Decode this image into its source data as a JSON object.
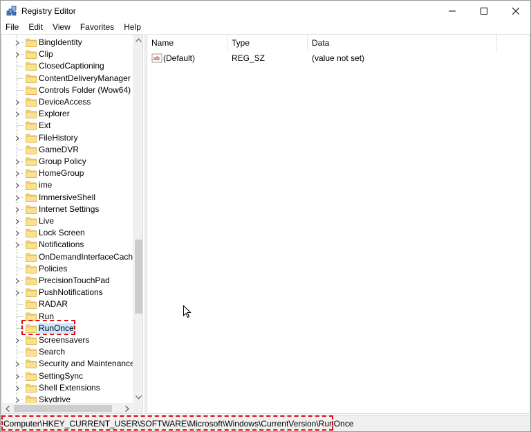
{
  "window": {
    "title": "Registry Editor",
    "controls": {
      "minimize": "—",
      "maximize": "☐",
      "close": "✕"
    }
  },
  "menu": [
    "File",
    "Edit",
    "View",
    "Favorites",
    "Help"
  ],
  "tree": {
    "items": [
      {
        "label": "BingIdentity",
        "expandable": true
      },
      {
        "label": "Clip",
        "expandable": true
      },
      {
        "label": "ClosedCaptioning",
        "expandable": false
      },
      {
        "label": "ContentDeliveryManager",
        "expandable": false
      },
      {
        "label": "Controls Folder (Wow64)",
        "expandable": false
      },
      {
        "label": "DeviceAccess",
        "expandable": true
      },
      {
        "label": "Explorer",
        "expandable": true
      },
      {
        "label": "Ext",
        "expandable": false
      },
      {
        "label": "FileHistory",
        "expandable": true
      },
      {
        "label": "GameDVR",
        "expandable": false
      },
      {
        "label": "Group Policy",
        "expandable": true
      },
      {
        "label": "HomeGroup",
        "expandable": true
      },
      {
        "label": "ime",
        "expandable": true
      },
      {
        "label": "ImmersiveShell",
        "expandable": true
      },
      {
        "label": "Internet Settings",
        "expandable": true
      },
      {
        "label": "Live",
        "expandable": true
      },
      {
        "label": "Lock Screen",
        "expandable": true
      },
      {
        "label": "Notifications",
        "expandable": true
      },
      {
        "label": "OnDemandInterfaceCache",
        "expandable": false
      },
      {
        "label": "Policies",
        "expandable": false
      },
      {
        "label": "PrecisionTouchPad",
        "expandable": true
      },
      {
        "label": "PushNotifications",
        "expandable": true
      },
      {
        "label": "RADAR",
        "expandable": false
      },
      {
        "label": "Run",
        "expandable": false
      },
      {
        "label": "RunOnce",
        "expandable": false,
        "selected": true
      },
      {
        "label": "Screensavers",
        "expandable": true
      },
      {
        "label": "Search",
        "expandable": false
      },
      {
        "label": "Security and Maintenance",
        "expandable": true
      },
      {
        "label": "SettingSync",
        "expandable": true
      },
      {
        "label": "Shell Extensions",
        "expandable": true
      },
      {
        "label": "Skydrive",
        "expandable": true
      }
    ]
  },
  "values": {
    "columns": {
      "name": "Name",
      "type": "Type",
      "data": "Data"
    },
    "rows": [
      {
        "name": "(Default)",
        "type": "REG_SZ",
        "data": "(value not set)",
        "icon": "string-value-icon"
      }
    ]
  },
  "status_bar": {
    "path": "Computer\\HKEY_CURRENT_USER\\SOFTWARE\\Microsoft\\Windows\\CurrentVersion\\RunOnce"
  },
  "colors": {
    "selection": "#cce8ff",
    "highlight": "#e0101a",
    "folder": "#f7d774"
  }
}
